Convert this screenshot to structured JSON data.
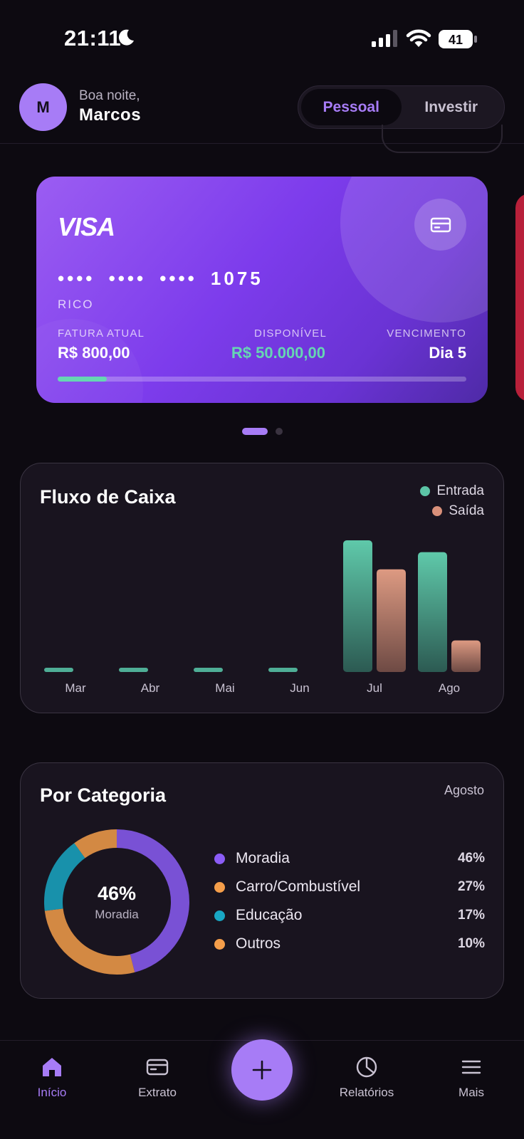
{
  "status_bar": {
    "time": "21:11",
    "battery": "41"
  },
  "header": {
    "avatar_initial": "M",
    "greeting": "Boa noite,",
    "user_name": "Marcos",
    "toggle": {
      "options": [
        "Pessoal",
        "Investir"
      ],
      "selected": "Pessoal"
    }
  },
  "card": {
    "brand": "VISA",
    "number_masked": "•••• •••• •••• 1075",
    "holder": "RICO",
    "fatura_label": "FATURA ATUAL",
    "fatura_value": "R$ 800,00",
    "disponivel_label": "DISPONÍVEL",
    "disponivel_value": "R$ 50.000,00",
    "vencimento_label": "VENCIMENTO",
    "vencimento_value": "Dia 5",
    "usage_fraction": 0.12,
    "colors": {
      "accent": "#a77cf6",
      "available": "#66d6b3"
    }
  },
  "carousel": {
    "pages": 2,
    "active": 0
  },
  "cash_flow": {
    "title": "Fluxo de Caixa",
    "legend": [
      "Entrada",
      "Saída"
    ]
  },
  "chart_data": {
    "type": "bar",
    "title": "Fluxo de Caixa",
    "categories": [
      "Mar",
      "Abr",
      "Mai",
      "Jun",
      "Jul",
      "Ago"
    ],
    "series": [
      {
        "name": "Entrada",
        "values": [
          0,
          0,
          0,
          0,
          1000,
          910
        ],
        "color": "#5cc4a6"
      },
      {
        "name": "Saída",
        "values": [
          0,
          0,
          0,
          0,
          780,
          240
        ],
        "color": "#d9907a"
      }
    ],
    "ylim": [
      0,
      1000
    ],
    "grid": false,
    "legend_position": "top-right"
  },
  "category": {
    "title": "Por Categoria",
    "month": "Agosto",
    "center_value": "46%",
    "center_label": "Moradia",
    "items": [
      {
        "name": "Moradia",
        "pct": "46%",
        "color": "#8b5cf6"
      },
      {
        "name": "Carro/Combustível",
        "pct": "27%",
        "color": "#f59e4a"
      },
      {
        "name": "Educação",
        "pct": "17%",
        "color": "#19a7c4"
      },
      {
        "name": "Outros",
        "pct": "10%",
        "color": "#f59e4a"
      }
    ]
  },
  "nav": {
    "items": [
      {
        "label": "Início",
        "icon": "home-icon",
        "active": true
      },
      {
        "label": "Extrato",
        "icon": "card-icon",
        "active": false
      },
      {
        "label": "Relatórios",
        "icon": "pie-chart-icon",
        "active": false
      },
      {
        "label": "Mais",
        "icon": "menu-icon",
        "active": false
      }
    ],
    "fab_icon": "plus-icon"
  }
}
